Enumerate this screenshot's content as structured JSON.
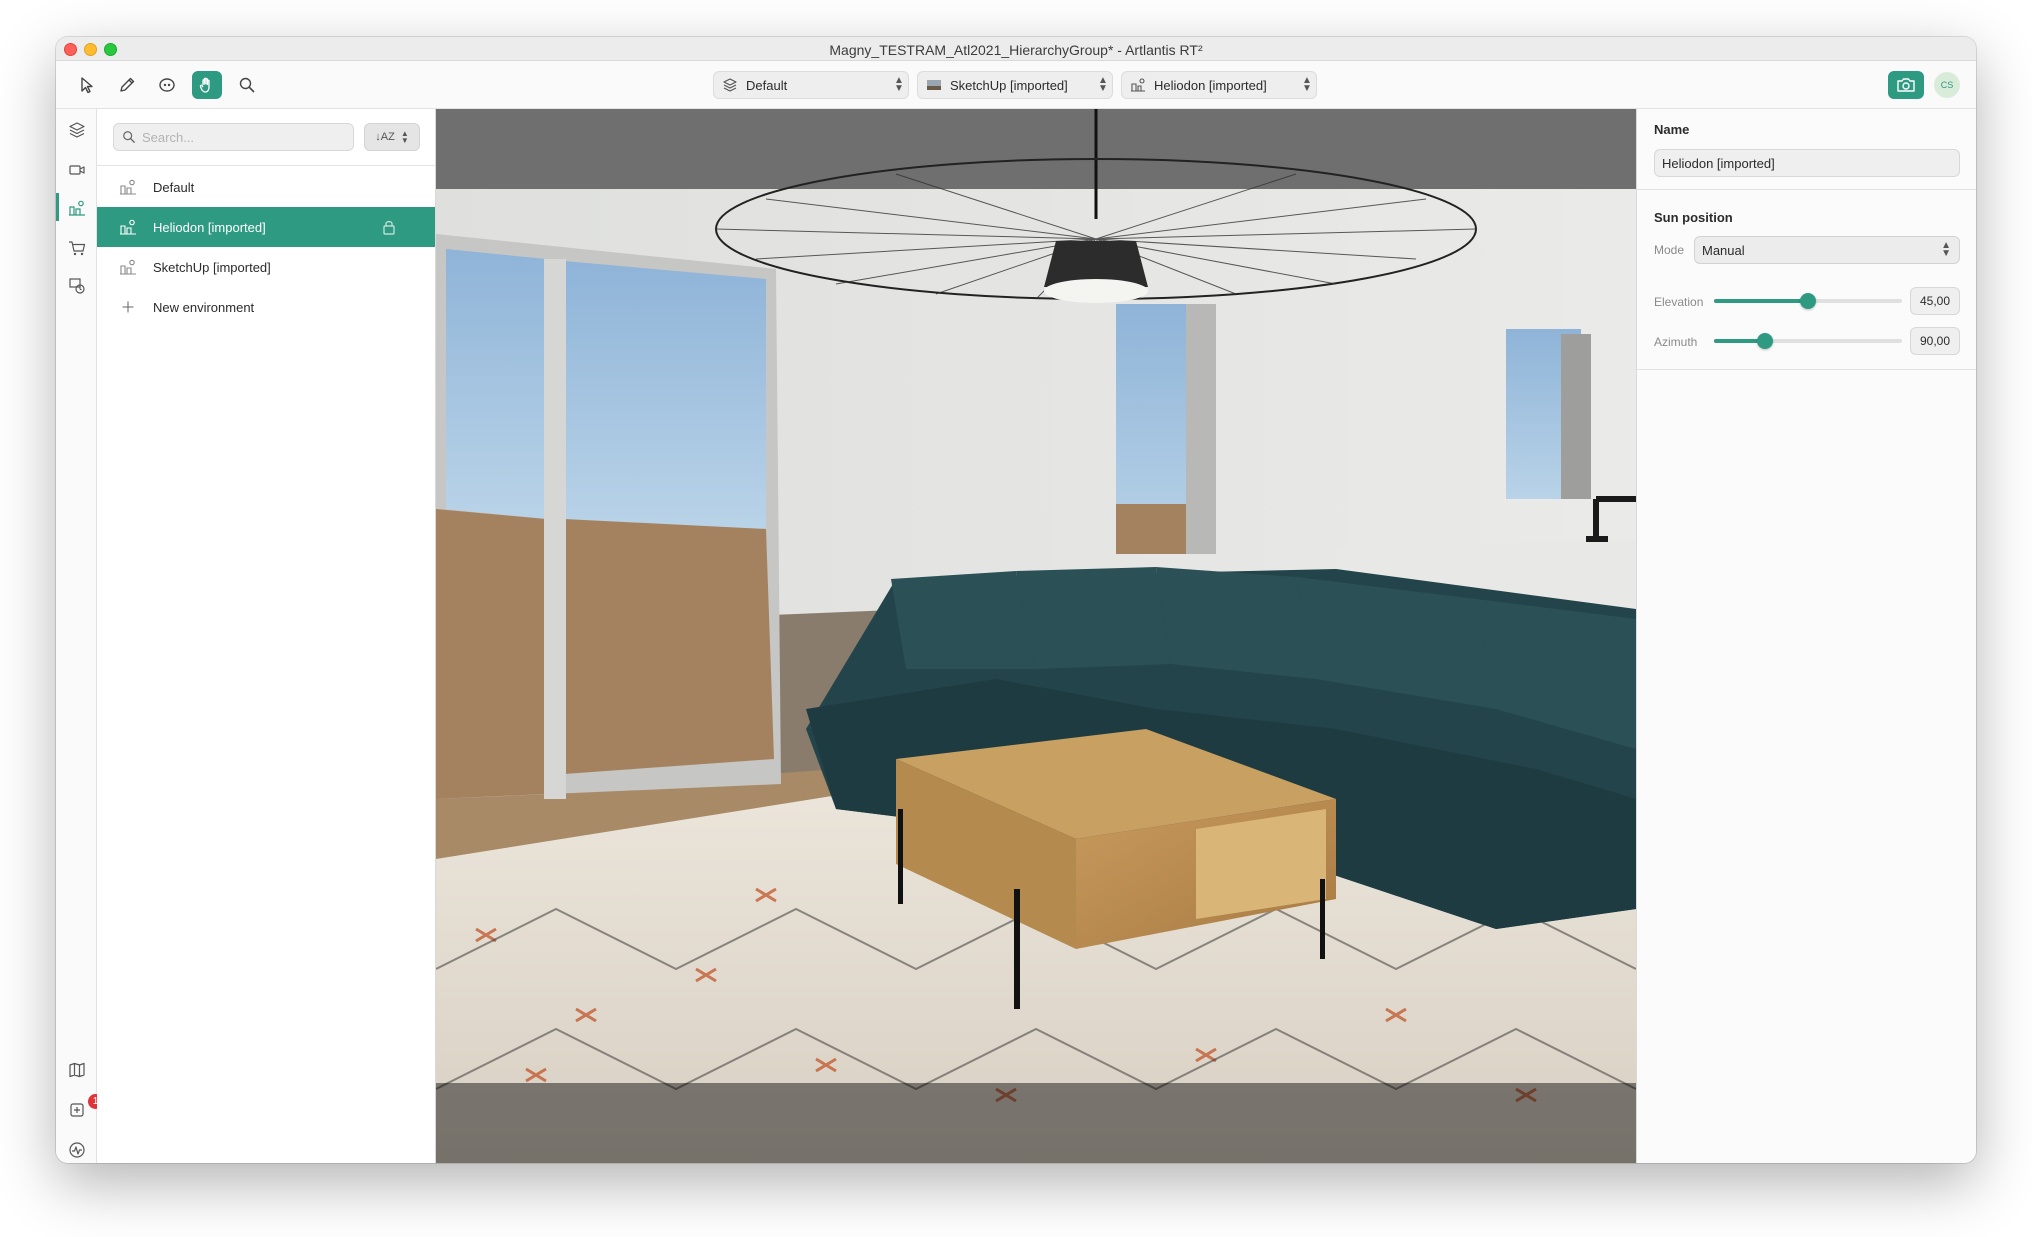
{
  "window": {
    "title": "Magny_TESTRAM_Atl2021_HierarchyGroup* - Artlantis RT²"
  },
  "toolbar": {
    "tools": [
      {
        "name": "select-tool",
        "icon": "arrow-pointer-icon"
      },
      {
        "name": "pen-tool",
        "icon": "pen-icon"
      },
      {
        "name": "orbit-tool",
        "icon": "orbit-icon"
      },
      {
        "name": "pan-tool",
        "icon": "hand-icon",
        "active": true
      },
      {
        "name": "zoom-tool",
        "icon": "magnifier-icon"
      }
    ],
    "layer_dropdown": "Default",
    "view_dropdown": "SketchUp [imported]",
    "environment_dropdown": "Heliodon [imported]",
    "avatar_initials": "CS",
    "accent_color": "#2e9a82"
  },
  "rail": {
    "badge_count": "1",
    "icons": [
      "layers-icon",
      "camera-icon",
      "heliodon-icon",
      "cart-icon",
      "objects-icon",
      "map-book-icon",
      "notifications-icon",
      "activity-icon"
    ]
  },
  "list": {
    "search_placeholder": "Search...",
    "sort_label": "↓AZ",
    "items": [
      {
        "label": "Default"
      },
      {
        "label": "Heliodon [imported]",
        "selected": true,
        "locked": true
      },
      {
        "label": "SketchUp [imported]"
      }
    ],
    "new_item_label": "New environment"
  },
  "inspector": {
    "name_heading": "Name",
    "name_value": "Heliodon [imported]",
    "sun_heading": "Sun position",
    "mode_label": "Mode",
    "mode_value": "Manual",
    "elevation_label": "Elevation",
    "elevation_value": "45,00",
    "elevation_fraction": 0.5,
    "azimuth_label": "Azimuth",
    "azimuth_value": "90,00",
    "azimuth_fraction": 0.27
  }
}
